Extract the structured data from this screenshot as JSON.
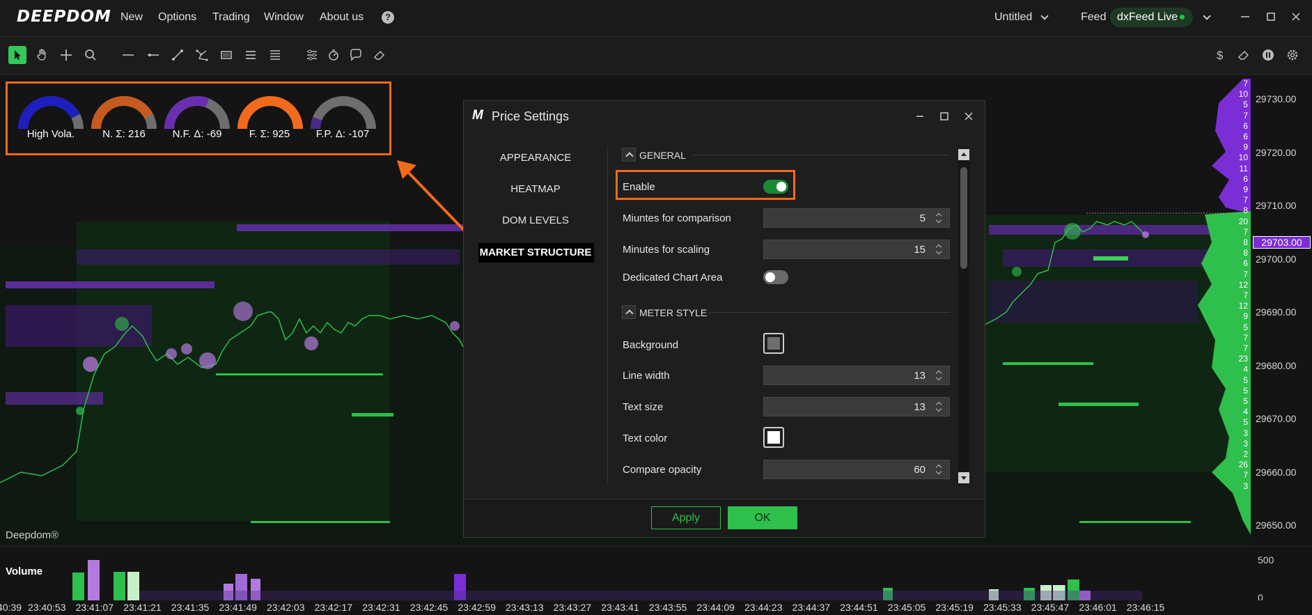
{
  "app": {
    "logo": "DEEPDOM",
    "menu": [
      "New",
      "Options",
      "Trading",
      "Window",
      "About us"
    ],
    "workspace": "Untitled",
    "feed_label": "Feed",
    "feed_name": "dxFeed Live",
    "status_color": "#1ec84b"
  },
  "toolbar": {
    "tools": [
      "select-cursor",
      "hand",
      "crosshair",
      "zoom",
      "horizontal-line",
      "ray",
      "trend-line",
      "polyline",
      "rectangle",
      "horizontal-lines",
      "parallel-lines",
      "settings-sliders",
      "timer",
      "comment",
      "eraser"
    ],
    "right_tools": [
      "dollar",
      "eraser",
      "pause",
      "settings"
    ]
  },
  "meters": [
    {
      "label": "High Vola.",
      "color": "#1d1fbf",
      "level": 0.85
    },
    {
      "label": "N. Σ: 216",
      "color": "#c65a1f",
      "level": 0.85
    },
    {
      "label": "N.F. Δ: -69",
      "color": "#6a2fb0",
      "level": 0.62
    },
    {
      "label": "F. Σ: 925",
      "color": "#f26a1b",
      "level": 1.0
    },
    {
      "label": "F.P. Δ: -107",
      "color": "#4b2a88",
      "level": 0.12
    }
  ],
  "chart": {
    "price_labels": [
      "29730.00",
      "29720.00",
      "29710.00",
      "29700.00",
      "29690.00",
      "29680.00",
      "29670.00",
      "29660.00",
      "29650.00"
    ],
    "current_price": "29703.00",
    "dom_volumes": [
      "7",
      "10",
      "5",
      "7",
      "6",
      "6",
      "9",
      "10",
      "11",
      "6",
      "9",
      "7",
      "8",
      "20",
      "7",
      "8",
      "8",
      "6",
      "7",
      "12",
      "7",
      "12",
      "9",
      "5",
      "7",
      "7",
      "23",
      "4",
      "5",
      "5",
      "5",
      "4",
      "5",
      "3",
      "3",
      "2",
      "26",
      "7",
      "3"
    ],
    "watermark": "Deepdom®"
  },
  "volume": {
    "label": "Volume",
    "axis": [
      "500",
      "0"
    ]
  },
  "time_axis": [
    "40:39",
    "23:40:53",
    "23:41:07",
    "23:41:21",
    "23:41:35",
    "23:41:49",
    "23:42:03",
    "23:42:17",
    "23:42:31",
    "23:42:45",
    "23:42:59",
    "23:43:13",
    "23:43:27",
    "23:43:41",
    "23:43:55",
    "23:44:09",
    "23:44:23",
    "23:44:37",
    "23:44:51",
    "23:45:05",
    "23:45:19",
    "23:45:33",
    "23:45:47",
    "23:46:01",
    "23:46:15"
  ],
  "dialog": {
    "title": "Price Settings",
    "nav": [
      "APPEARANCE",
      "HEATMAP",
      "DOM LEVELS",
      "MARKET STRUCTURE"
    ],
    "active_nav": "MARKET STRUCTURE",
    "general": {
      "heading": "GENERAL",
      "enable_label": "Enable",
      "enable_on": true,
      "comparison_label": "Miuntes for comparison",
      "comparison_value": "5",
      "scaling_label": "Minutes for scaling",
      "scaling_value": "15",
      "dedicated_label": "Dedicated Chart Area",
      "dedicated_on": false
    },
    "meter_style": {
      "heading": "METER STYLE",
      "background_label": "Background",
      "background_color": "#6e6e6e",
      "line_width_label": "Line width",
      "line_width_value": "13",
      "text_size_label": "Text size",
      "text_size_value": "13",
      "text_color_label": "Text color",
      "text_color": "#ffffff",
      "opacity_label": "Compare opacity",
      "opacity_value": "60"
    },
    "apply_label": "Apply",
    "ok_label": "OK"
  }
}
